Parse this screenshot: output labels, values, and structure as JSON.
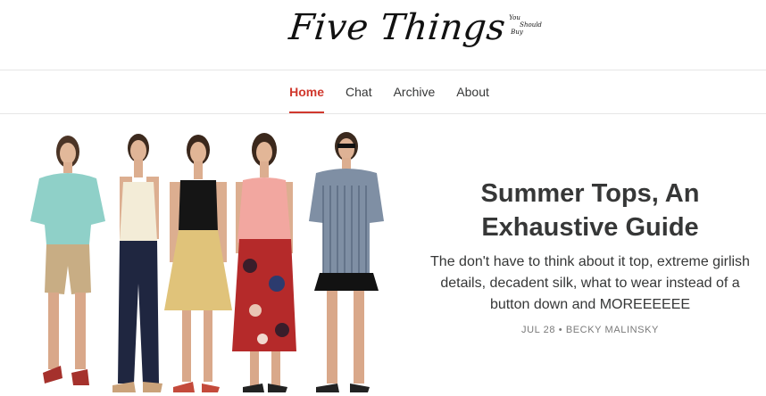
{
  "site": {
    "logo_main": "Five Things",
    "logo_sub": [
      "You",
      "Should",
      "Buy"
    ]
  },
  "nav": {
    "items": [
      {
        "label": "Home",
        "active": true
      },
      {
        "label": "Chat",
        "active": false
      },
      {
        "label": "Archive",
        "active": false
      },
      {
        "label": "About",
        "active": false
      }
    ]
  },
  "post": {
    "title": "Summer Tops, An Exhaustive Guide",
    "subtitle": "The don't have to think about it top, extreme girlish details, decadent silk, what to wear instead of a button down and MOREEEEEE",
    "date": "JUL 28",
    "separator": "•",
    "author": "BECKY MALINSKY",
    "accent_color": "#d0382d"
  }
}
